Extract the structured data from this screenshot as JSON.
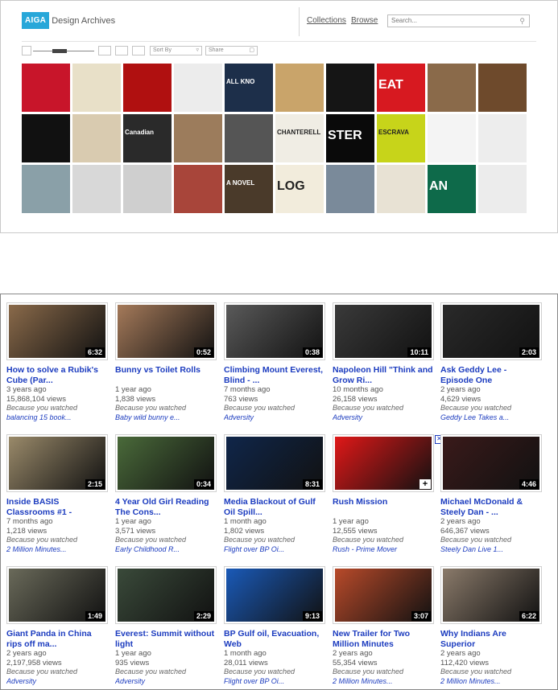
{
  "aiga": {
    "logo_mark": "AIGA",
    "logo_text": "Design Archives",
    "nav": {
      "collections": "Collections",
      "browse": "Browse"
    },
    "search_placeholder": "Search...",
    "toolbar": {
      "sort_by": "Sort By",
      "share": "Share"
    },
    "tiles": [
      {
        "bg": "#c8152a",
        "text": ""
      },
      {
        "bg": "#e8e0c8",
        "text": ""
      },
      {
        "bg": "#b01010",
        "text": ""
      },
      {
        "bg": "#ececec",
        "text": ""
      },
      {
        "bg": "#1d2f4a",
        "text": "ALL KNO"
      },
      {
        "bg": "#c9a46a",
        "text": ""
      },
      {
        "bg": "#151515",
        "text": ""
      },
      {
        "bg": "#d71920",
        "text": "EAT"
      },
      {
        "bg": "#8a6a4a",
        "text": ""
      },
      {
        "bg": "#6e4a2c",
        "text": ""
      },
      {
        "bg": "#111111",
        "text": ""
      },
      {
        "bg": "#d9cbb0",
        "text": ""
      },
      {
        "bg": "#2a2a2a",
        "text": "Canadian"
      },
      {
        "bg": "#9c7c5c",
        "text": ""
      },
      {
        "bg": "#555555",
        "text": ""
      },
      {
        "bg": "#f0ede4",
        "text": "CHANTERELL"
      },
      {
        "bg": "#0a0a0a",
        "text": "STER"
      },
      {
        "bg": "#c7d41a",
        "text": "ESCRAVA"
      },
      {
        "bg": "#f4f4f4",
        "text": ""
      },
      {
        "bg": "#ededed",
        "text": ""
      },
      {
        "bg": "#8aa0a8",
        "text": ""
      },
      {
        "bg": "#d8d8d8",
        "text": ""
      },
      {
        "bg": "#cfcfcf",
        "text": ""
      },
      {
        "bg": "#a8453a",
        "text": ""
      },
      {
        "bg": "#4a3a2a",
        "text": "A NOVEL"
      },
      {
        "bg": "#f2ecdc",
        "text": "LOG"
      },
      {
        "bg": "#7a8a9a",
        "text": ""
      },
      {
        "bg": "#e8e2d4",
        "text": ""
      },
      {
        "bg": "#0e6a4a",
        "text": "AN"
      },
      {
        "bg": "#ececec",
        "text": ""
      }
    ]
  },
  "youtube": {
    "because_label": "Because you watched",
    "videos": [
      {
        "title": "How to solve a Rubik's Cube (Par...",
        "age": "3 years ago",
        "views": "15,868,104 views",
        "source": "balancing 15 book...",
        "duration": "6:32",
        "thumb": "#8a6a4a"
      },
      {
        "title": "Bunny vs Toilet Rolls",
        "age": "1 year ago",
        "views": "1,838 views",
        "source": "Baby wild bunny e...",
        "duration": "0:52",
        "thumb": "#a57a5a"
      },
      {
        "title": "Climbing Mount Everest, Blind - ...",
        "age": "7 months ago",
        "views": "763 views",
        "source": "Adversity",
        "duration": "0:38",
        "thumb": "#5a5a5a"
      },
      {
        "title": "Napoleon Hill \"Think and Grow Ri...",
        "age": "10 months ago",
        "views": "26,158 views",
        "source": "Adversity",
        "duration": "10:11",
        "thumb": "#3a3a3a"
      },
      {
        "title": "Ask Geddy Lee - Episode One",
        "age": "2 years ago",
        "views": "4,629 views",
        "source": "Geddy Lee Takes a...",
        "duration": "2:03",
        "thumb": "#2a2a2a"
      },
      {
        "title": "Inside BASIS Classrooms #1 -",
        "age": "7 months ago",
        "views": "1,218 views",
        "source": "2 Million Minutes...",
        "duration": "2:15",
        "thumb": "#9a8a6a"
      },
      {
        "title": "4 Year Old Girl Reading The Cons...",
        "age": "1 year ago",
        "views": "3,571 views",
        "source": "Early Childhood R...",
        "duration": "0:34",
        "thumb": "#4a6a3a"
      },
      {
        "title": "Media Blackout of Gulf Oil Spill...",
        "age": "1 month ago",
        "views": "1,802 views",
        "source": "Flight over BP Oi...",
        "duration": "8:31",
        "thumb": "#10264a"
      },
      {
        "title": "Rush Mission",
        "age": "1 year ago",
        "views": "12,555 views",
        "source": "Rush - Prime Mover",
        "duration": "",
        "thumb": "#e01818"
      },
      {
        "title": "Michael McDonald & Steely Dan - ...",
        "age": "2 years ago",
        "views": "646,367 views",
        "source": "Steely Dan Live 1...",
        "duration": "4:46",
        "thumb": "#3a1a1a"
      },
      {
        "title": "Giant Panda in China rips off ma...",
        "age": "2 years ago",
        "views": "2,197,958 views",
        "source": "Adversity",
        "duration": "1:49",
        "thumb": "#6a6a5a"
      },
      {
        "title": "Everest: Summit without light",
        "age": "1 year ago",
        "views": "935 views",
        "source": "Adversity",
        "duration": "2:29",
        "thumb": "#3a4a3a"
      },
      {
        "title": "BP Gulf oil, Evacuation, Web",
        "age": "1 month ago",
        "views": "28,011 views",
        "source": "Flight over BP Oi...",
        "duration": "9:13",
        "thumb": "#1a5ab8"
      },
      {
        "title": "New Trailer for Two Million Minutes",
        "age": "2 years ago",
        "views": "55,354 views",
        "source": "2 Million Minutes...",
        "duration": "3:07",
        "thumb": "#b84a2a"
      },
      {
        "title": "Why Indians Are Superior",
        "age": "2 years ago",
        "views": "112,420 views",
        "source": "2 Million Minutes...",
        "duration": "6:22",
        "thumb": "#8a7a6a"
      }
    ]
  }
}
